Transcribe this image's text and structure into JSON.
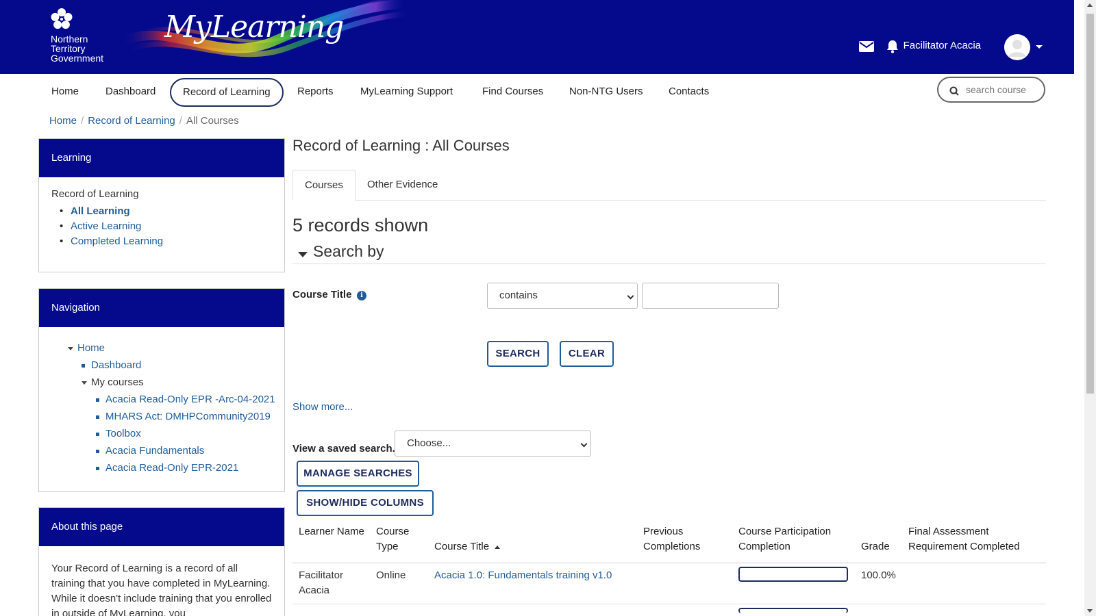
{
  "header": {
    "org_name": "Northern\nTerritory\nGovernment",
    "app_name": "MyLearning",
    "user_name": "Facilitator Acacia",
    "icons": [
      "envelope-icon",
      "bell-icon",
      "avatar",
      "chevron-down-icon"
    ]
  },
  "nav": {
    "items": [
      "Home",
      "Dashboard",
      "Record of Learning",
      "Reports",
      "MyLearning Support",
      "Find Courses",
      "Non-NTG Users",
      "Contacts"
    ],
    "active": "Record of Learning",
    "search_placeholder": "search course"
  },
  "breadcrumb": [
    "Home",
    "Record of Learning",
    "All Courses"
  ],
  "learning_block": {
    "title": "Learning",
    "subtitle": "Record of Learning",
    "links": [
      "All Learning",
      "Active Learning",
      "Completed Learning"
    ]
  },
  "navigation_block": {
    "title": "Navigation",
    "home": "Home",
    "dashboard": "Dashboard",
    "my_courses": "My courses",
    "courses": [
      "Acacia Read-Only EPR -Arc-04-2021",
      "MHARS Act: DMHPCommunity2019",
      "Toolbox",
      "Acacia Fundamentals",
      "Acacia Read-Only EPR-2021"
    ]
  },
  "about_block": {
    "title": "About this page",
    "text": "Your Record of Learning is a record of all training that you have completed in MyLearning. While it doesn't include training that you enrolled in outside of MyLearning, you"
  },
  "main": {
    "title": "Record of Learning : All Courses",
    "tabs": [
      "Courses",
      "Other Evidence"
    ],
    "records_shown": "5 records shown",
    "search_by": "Search by",
    "course_title_label": "Course Title",
    "operator_value": "contains",
    "search_value": "",
    "search_button": "SEARCH",
    "clear_button": "CLEAR",
    "show_more": "Show more...",
    "saved_search_label": "View a saved search...",
    "saved_search_value": "Choose...",
    "manage_searches": "MANAGE SEARCHES",
    "show_hide_columns": "SHOW/HIDE COLUMNS"
  },
  "table": {
    "columns": [
      "Learner Name",
      "Course Type",
      "Course Title",
      "Previous Completions",
      "Course Participation Completion",
      "Grade",
      "Final Assessment Requirement Completed"
    ],
    "rows": [
      {
        "learner": "Facilitator Acacia",
        "type": "Online",
        "title": "Acacia 1.0: Fundamentals training v1.0",
        "previous": "",
        "progress": 0,
        "grade": "100.0%",
        "final": ""
      }
    ]
  },
  "colors": {
    "header_bg": "#050a8c",
    "link": "#1f5c99",
    "button_border": "#1f5c99"
  }
}
